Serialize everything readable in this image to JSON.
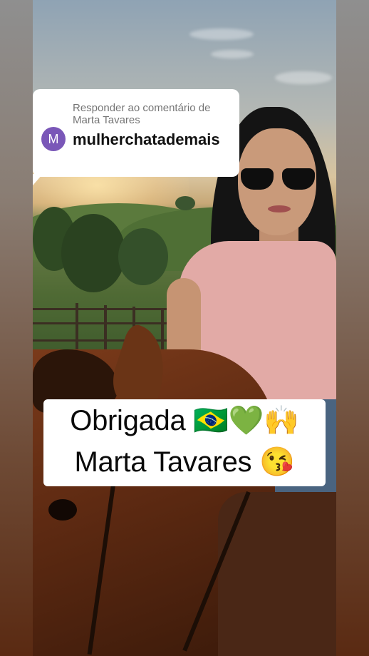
{
  "reply": {
    "heading": "Responder ao comentário de Marta Tavares",
    "avatar_letter": "M",
    "username": "mulherchatademais"
  },
  "caption": {
    "line1": "Obrigada 🇧🇷💚🙌",
    "line2": "Marta Tavares 😘"
  },
  "colors": {
    "avatar": "#7a57b8",
    "shirt": "#e2aaa6",
    "horse": "#6a3416"
  }
}
